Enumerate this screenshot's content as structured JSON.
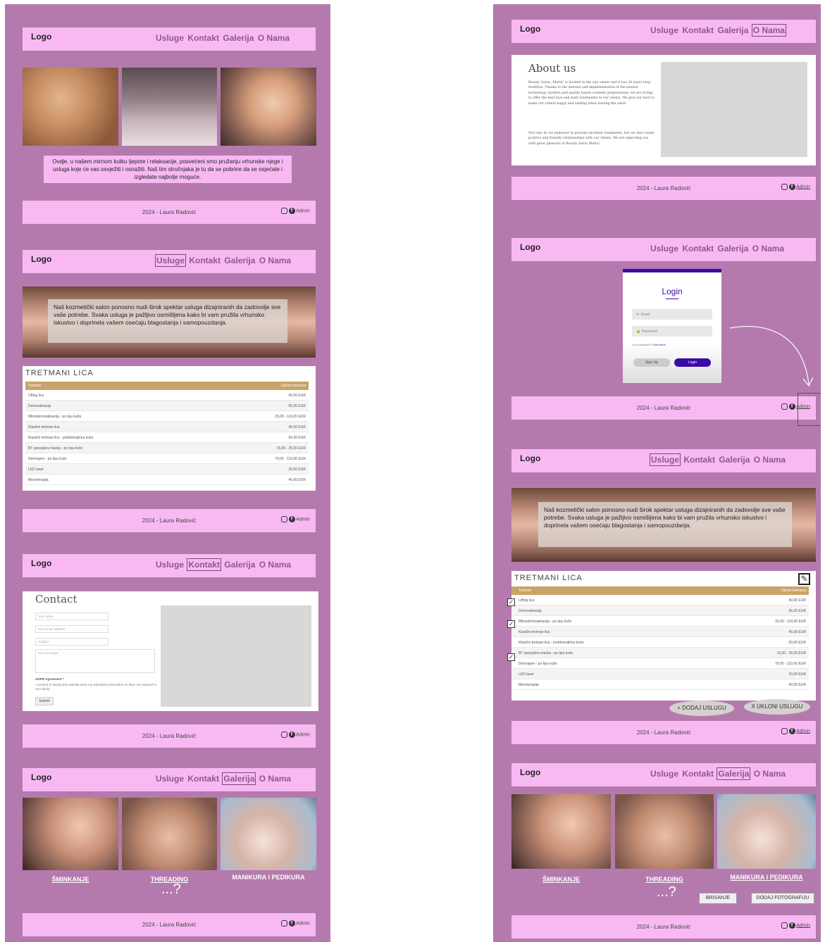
{
  "common": {
    "logo": "Logo",
    "nav": [
      "Usluge",
      "Kontakt",
      "Galerija",
      "O Nama"
    ],
    "footer": "2024 - Laura Radović",
    "admin": "Admin"
  },
  "left": {
    "home_text": "Ovdje, u našem mirnom kutku ljepote i relaksacije, posvećeni smo pružanju vrhunske njege i usluga koje će vas osvježiti i osnažiti. Naš tim stručnjaka je tu da se pobrine da se osjećate i izgledate najbolje moguće.",
    "services_text": "Naš kozmetički salon ponosno nudi širok spektar usluga dizajniranih da zadovolje sve vaše potrebe. Svaka usluga je pažljivo osmišljena kako bi vam pružila vrhunsko iskustvo i doprinela vašem osećaju blagostanja i samopouzdanja.",
    "table_title": "TRETMANI LICA",
    "table_head": [
      "Tretman",
      "Cijena tretmana"
    ],
    "rows": [
      [
        "Lifting lica",
        "40,00 EUR"
      ],
      [
        "Dermoabrazija",
        "55,00 EUR"
      ],
      [
        "Mikrodermoabrazija - po tipu kože",
        "35,00 - 110,00 EUR"
      ],
      [
        "Klasični tretman lica",
        "45,00 EUR"
      ],
      [
        "Klasični tretman lica - problematična koža",
        "50,00 EUR"
      ],
      [
        "BT specijalna maska - po tipu kože",
        "15,00 - 35,00 EUR"
      ],
      [
        "Dermapen - po tipu kože",
        "70,00 - 110,00 EUR"
      ],
      [
        "LED laser",
        "20,00 EUR"
      ],
      [
        "Mezoterapija",
        "40,00 EUR"
      ]
    ],
    "contact_title": "Contact",
    "contact_fields": [
      "Your name",
      "Your email address",
      "Subject",
      "Your message"
    ],
    "gdpr": "GDPR Agreement *",
    "gdpr_text": "I consent to having this website store my submitted information so they can respond to my inquiry.",
    "submit": "Submit",
    "gallery": [
      "ŠMINKANJE",
      "THREADING",
      "MANIKURA I PEDIKURA"
    ],
    "more": "...?"
  },
  "right": {
    "about_title": "About us",
    "about_p1": "Beauty Salon „Maria\" is located in the city center and it has 20 years long tradition. Thanks to the interest and implementation of the newest technology, modern and quality based cosmetic preparations, we are trying to offer the best face and body treatments to our clients. We give our best to make our clients happy and smiling when leaving the salon.",
    "about_p2": "Not only do we endeavor to provide excellent treatments, but we also create positive and friendly relationships with our clients. We are expecting you with great pleasure at Beauty Salon Maria!",
    "login_title": "Login",
    "email": "Email",
    "password": "Password",
    "lost": "Lost password?",
    "click": "Click here!",
    "signup": "Sign Up",
    "login_btn": "Login",
    "add": "+ DODAJ USLUGU",
    "remove": "X UKLONI USLUGU",
    "delete": "BRISANJE",
    "add_photo": "DODAJ FOTOGRAFIJU"
  }
}
